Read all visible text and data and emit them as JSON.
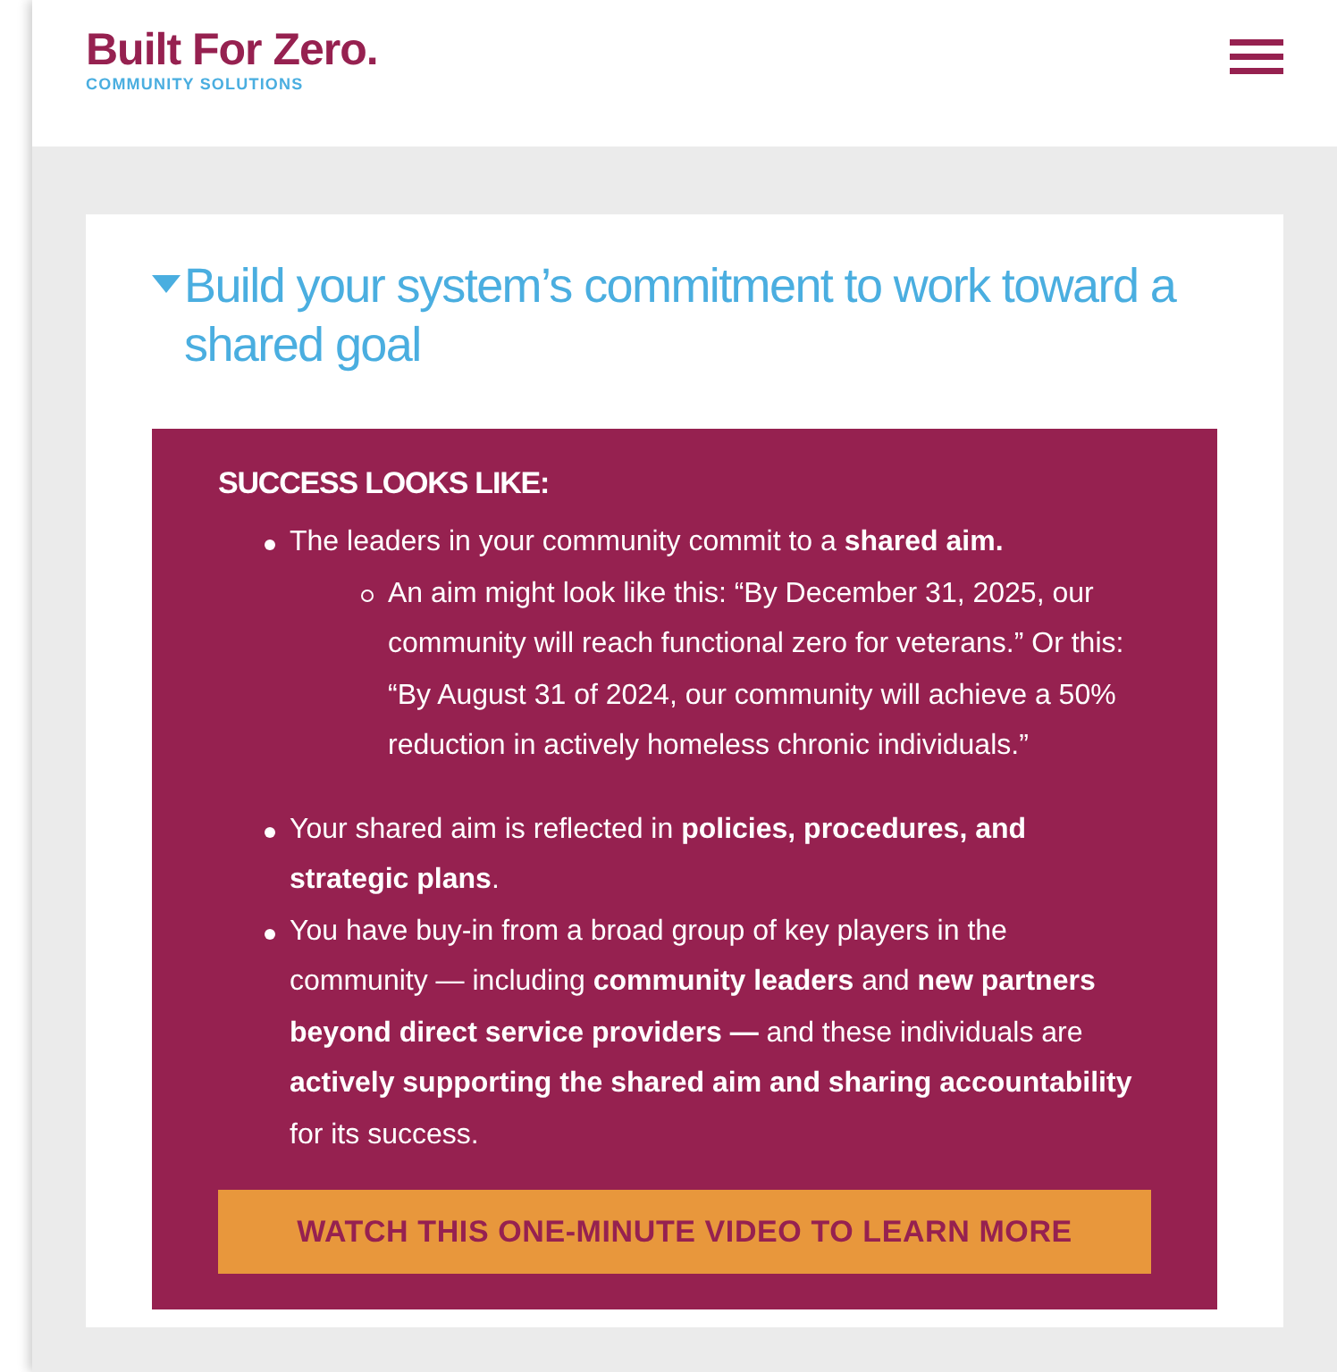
{
  "header": {
    "logo_title": "Built For Zero.",
    "logo_subtitle": "COMMUNITY SOLUTIONS"
  },
  "section": {
    "title": "Build your system’s commitment to work toward a shared goal",
    "expanded": true,
    "panel": {
      "heading": "SUCCESS LOOKS LIKE:",
      "items": [
        {
          "text": "The leaders in your community commit to a **shared aim.**",
          "children": [
            {
              "text": "An aim might look like this: “By December 31, 2025, our community will reach functional zero for veterans.” Or this: “By August 31 of 2024, our community will achieve a 50% reduction in actively homeless chronic individuals.”"
            }
          ]
        },
        {
          "text": "Your shared aim is reflected in **policies, procedures, and strategic plans**."
        },
        {
          "text": "You have buy-in from a broad group of key players in the community — including **community leaders** and **new partners beyond direct service providers —** and these individuals are **actively supporting the shared aim and sharing accountability** for its success."
        }
      ],
      "button": "WATCH THIS ONE-MINUTE VIDEO TO LEARN MORE"
    }
  }
}
